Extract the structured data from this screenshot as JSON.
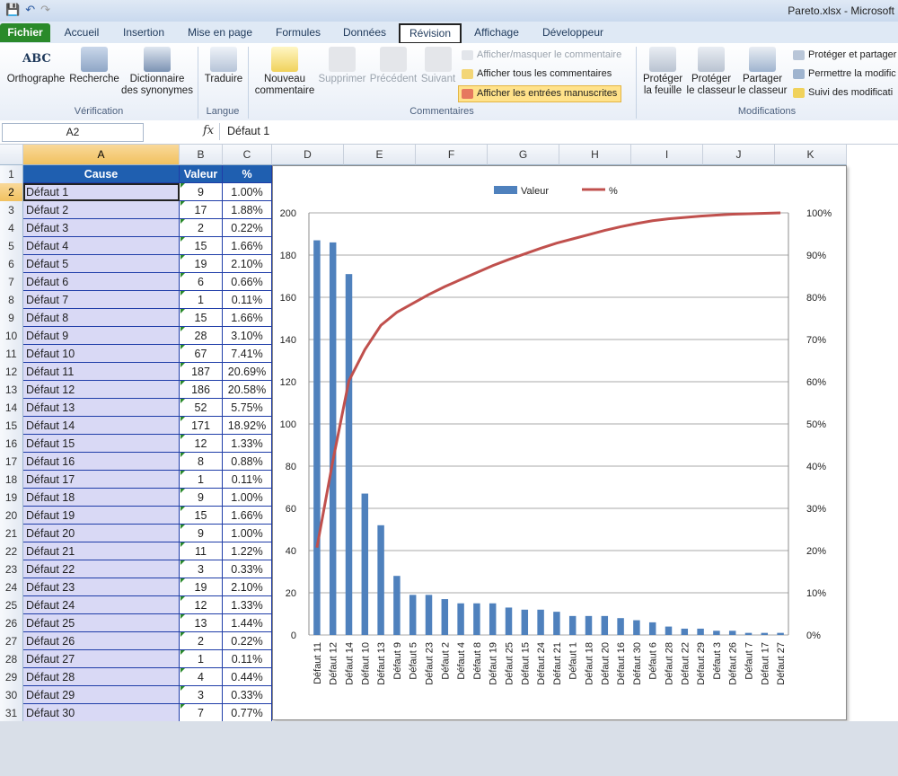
{
  "window": {
    "title": "Pareto.xlsx - Microsoft"
  },
  "qat": {
    "save": "💾",
    "undo": "↶",
    "redo": "↷"
  },
  "tabs": [
    "Fichier",
    "Accueil",
    "Insertion",
    "Mise en page",
    "Formules",
    "Données",
    "Révision",
    "Affichage",
    "Développeur"
  ],
  "active_tab": "Révision",
  "ribbon": {
    "groups": {
      "verification": "Vérification",
      "langue": "Langue",
      "commentaires": "Commentaires",
      "modifications": "Modifications"
    },
    "buttons": {
      "orthographe": "Orthographe",
      "recherche": "Recherche",
      "dictionnaire_1": "Dictionnaire",
      "dictionnaire_2": "des synonymes",
      "traduire": "Traduire",
      "nouveau_1": "Nouveau",
      "nouveau_2": "commentaire",
      "supprimer": "Supprimer",
      "precedent": "Précédent",
      "suivant": "Suivant",
      "afficher_masquer": "Afficher/masquer le commentaire",
      "afficher_tous": "Afficher tous les commentaires",
      "afficher_entrees": "Afficher les entrées manuscrites",
      "proteger_feuille_1": "Protéger",
      "proteger_feuille_2": "la feuille",
      "proteger_classeur_1": "Protéger",
      "proteger_classeur_2": "le classeur",
      "partager_1": "Partager",
      "partager_2": "le classeur",
      "proteger_partager": "Protéger et partager",
      "permettre": "Permettre la modific",
      "suivi": "Suivi des modificati"
    },
    "abc_label": "ABC"
  },
  "formula_bar": {
    "name_box": "A2",
    "fx": "fx",
    "value": "Défaut 1"
  },
  "columns": [
    "A",
    "B",
    "C",
    "D",
    "E",
    "F",
    "G",
    "H",
    "I",
    "J",
    "K"
  ],
  "header_row": {
    "cause": "Cause",
    "valeur": "Valeur",
    "pct": "%"
  },
  "rows": [
    {
      "n": "2",
      "cause": "Défaut 1",
      "val": "9",
      "pct": "1.00%"
    },
    {
      "n": "3",
      "cause": "Défaut 2",
      "val": "17",
      "pct": "1.88%"
    },
    {
      "n": "4",
      "cause": "Défaut 3",
      "val": "2",
      "pct": "0.22%"
    },
    {
      "n": "5",
      "cause": "Défaut 4",
      "val": "15",
      "pct": "1.66%"
    },
    {
      "n": "6",
      "cause": "Défaut 5",
      "val": "19",
      "pct": "2.10%"
    },
    {
      "n": "7",
      "cause": "Défaut 6",
      "val": "6",
      "pct": "0.66%"
    },
    {
      "n": "8",
      "cause": "Défaut 7",
      "val": "1",
      "pct": "0.11%"
    },
    {
      "n": "9",
      "cause": "Défaut 8",
      "val": "15",
      "pct": "1.66%"
    },
    {
      "n": "10",
      "cause": "Défaut 9",
      "val": "28",
      "pct": "3.10%"
    },
    {
      "n": "11",
      "cause": "Défaut 10",
      "val": "67",
      "pct": "7.41%"
    },
    {
      "n": "12",
      "cause": "Défaut 11",
      "val": "187",
      "pct": "20.69%"
    },
    {
      "n": "13",
      "cause": "Défaut 12",
      "val": "186",
      "pct": "20.58%"
    },
    {
      "n": "14",
      "cause": "Défaut 13",
      "val": "52",
      "pct": "5.75%"
    },
    {
      "n": "15",
      "cause": "Défaut 14",
      "val": "171",
      "pct": "18.92%"
    },
    {
      "n": "16",
      "cause": "Défaut 15",
      "val": "12",
      "pct": "1.33%"
    },
    {
      "n": "17",
      "cause": "Défaut 16",
      "val": "8",
      "pct": "0.88%"
    },
    {
      "n": "18",
      "cause": "Défaut 17",
      "val": "1",
      "pct": "0.11%"
    },
    {
      "n": "19",
      "cause": "Défaut 18",
      "val": "9",
      "pct": "1.00%"
    },
    {
      "n": "20",
      "cause": "Défaut 19",
      "val": "15",
      "pct": "1.66%"
    },
    {
      "n": "21",
      "cause": "Défaut 20",
      "val": "9",
      "pct": "1.00%"
    },
    {
      "n": "22",
      "cause": "Défaut 21",
      "val": "11",
      "pct": "1.22%"
    },
    {
      "n": "23",
      "cause": "Défaut 22",
      "val": "3",
      "pct": "0.33%"
    },
    {
      "n": "24",
      "cause": "Défaut 23",
      "val": "19",
      "pct": "2.10%"
    },
    {
      "n": "25",
      "cause": "Défaut 24",
      "val": "12",
      "pct": "1.33%"
    },
    {
      "n": "26",
      "cause": "Défaut 25",
      "val": "13",
      "pct": "1.44%"
    },
    {
      "n": "27",
      "cause": "Défaut 26",
      "val": "2",
      "pct": "0.22%"
    },
    {
      "n": "28",
      "cause": "Défaut 27",
      "val": "1",
      "pct": "0.11%"
    },
    {
      "n": "29",
      "cause": "Défaut 28",
      "val": "4",
      "pct": "0.44%"
    },
    {
      "n": "30",
      "cause": "Défaut 29",
      "val": "3",
      "pct": "0.33%"
    },
    {
      "n": "31",
      "cause": "Défaut 30",
      "val": "7",
      "pct": "0.77%"
    }
  ],
  "chart_data": {
    "type": "bar",
    "categories": [
      "Défaut 11",
      "Défaut 12",
      "Défaut 14",
      "Défaut 10",
      "Défaut 13",
      "Défaut 9",
      "Défaut 5",
      "Défaut 23",
      "Défaut 2",
      "Défaut 4",
      "Défaut 8",
      "Défaut 19",
      "Défaut 25",
      "Défaut 15",
      "Défaut 24",
      "Défaut 21",
      "Défaut 1",
      "Défaut 18",
      "Défaut 20",
      "Défaut 16",
      "Défaut 30",
      "Défaut 6",
      "Défaut 28",
      "Défaut 22",
      "Défaut 29",
      "Défaut 3",
      "Défaut 26",
      "Défaut 7",
      "Défaut 17",
      "Défaut 27"
    ],
    "series": [
      {
        "name": "Valeur",
        "axis": "left",
        "type": "bar",
        "color": "#4f81bd",
        "values": [
          187,
          186,
          171,
          67,
          52,
          28,
          19,
          19,
          17,
          15,
          15,
          15,
          13,
          12,
          12,
          11,
          9,
          9,
          9,
          8,
          7,
          6,
          4,
          3,
          3,
          2,
          2,
          1,
          1,
          1
        ]
      },
      {
        "name": "%",
        "axis": "right",
        "type": "line",
        "color": "#c0504d",
        "values": [
          20.69,
          41.27,
          60.19,
          67.6,
          73.35,
          76.45,
          78.55,
          80.65,
          82.53,
          84.19,
          85.85,
          87.51,
          88.95,
          90.28,
          91.61,
          92.83,
          93.83,
          94.83,
          95.83,
          96.71,
          97.48,
          98.14,
          98.58,
          98.91,
          99.24,
          99.46,
          99.68,
          99.79,
          99.9,
          100
        ]
      }
    ],
    "y_left": {
      "min": 0,
      "max": 200,
      "ticks": [
        "0",
        "20",
        "40",
        "60",
        "80",
        "100",
        "120",
        "140",
        "160",
        "180",
        "200"
      ]
    },
    "y_right": {
      "min": 0,
      "max": 100,
      "ticks": [
        "0%",
        "10%",
        "20%",
        "30%",
        "40%",
        "50%",
        "60%",
        "70%",
        "80%",
        "90%",
        "100%"
      ]
    },
    "grid": true,
    "legend": "top-center"
  }
}
